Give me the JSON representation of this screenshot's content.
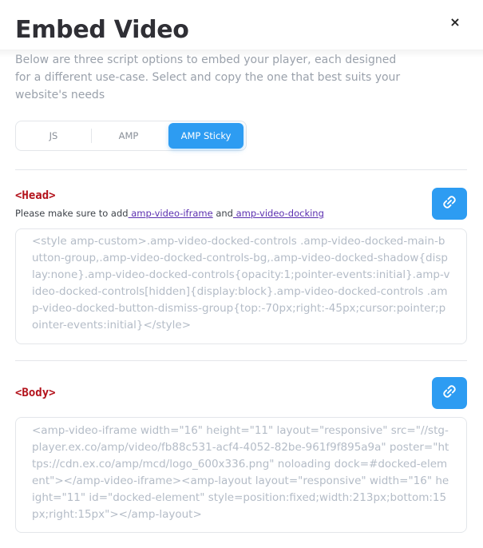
{
  "dialog": {
    "title": "Embed Video",
    "close_label": "×",
    "description": "Below are three script options to embed your player, each designed for a different use-case. Select and copy the one that best suits your website's needs"
  },
  "tabs": [
    {
      "label": "JS",
      "active": false
    },
    {
      "label": "AMP",
      "active": false
    },
    {
      "label": "AMP Sticky",
      "active": true
    }
  ],
  "head": {
    "label": "<Head>",
    "hint_prefix": "Please make sure to add",
    "link1": " amp-video-iframe",
    "hint_mid": " and",
    "link2": " amp-video-docking",
    "code": "<style amp-custom>.amp-video-docked-controls .amp-video-docked-main-button-group,.amp-video-docked-controls-bg,.amp-video-docked-shadow{display:none}.amp-video-docked-controls{opacity:1;pointer-events:initial}.amp-video-docked-controls[hidden]{display:block}.amp-video-docked-controls .amp-video-docked-button-dismiss-group{top:-70px;right:-45px;cursor:pointer;pointer-events:initial}</style>"
  },
  "body": {
    "label": "<Body>",
    "code": "<amp-video-iframe width=\"16\" height=\"11\" layout=\"responsive\" src=\"//stg-player.ex.co/amp/video/fb88c531-acf4-4052-82be-961f9f895a9a\" poster=\"https://cdn.ex.co/amp/mcd/logo_600x336.png\" noloading dock=#docked-element\"></amp-video-iframe><amp-layout layout=\"responsive\" width=\"16\" height=\"11\" id=\"docked-element\" style=position:fixed;width:213px;bottom:15px;right:15px\"></amp-layout>"
  },
  "colors": {
    "accent": "#2d9cf2",
    "section_label": "#b3121b",
    "code_text": "#b4bcc7"
  },
  "icons": {
    "copy": "link-copy-icon",
    "close": "close-icon"
  }
}
